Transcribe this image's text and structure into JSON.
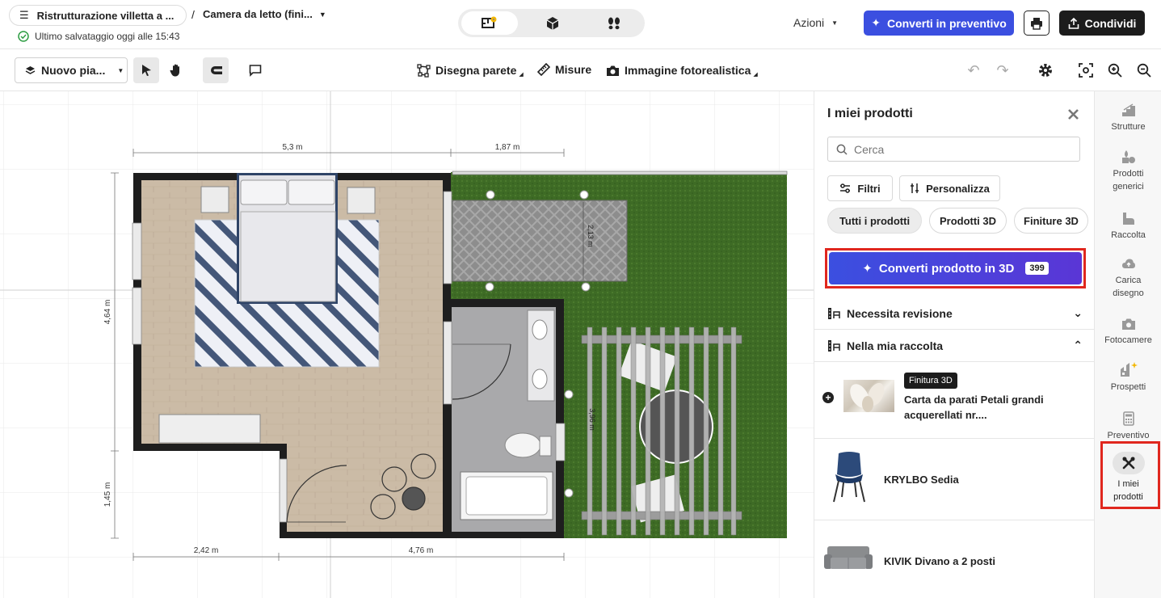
{
  "header": {
    "project_title": "Ristrutturazione villetta a ...",
    "separator": "/",
    "room_title": "Camera da letto (fini...",
    "save_status": "Ultimo salvataggio oggi alle 15:43",
    "actions_label": "Azioni",
    "convert_quote_label": "Converti in preventivo",
    "share_label": "Condividi"
  },
  "toolbar": {
    "floor_select": "Nuovo pia...",
    "draw_wall": "Disegna parete",
    "measures": "Misure",
    "photoreal": "Immagine fotorealistica"
  },
  "plan": {
    "dims": {
      "top_left": "5,3 m",
      "top_right": "1,87 m",
      "left_upper": "4,64 m",
      "left_lower": "1,45 m",
      "bottom_left": "2,42 m",
      "bottom_right": "4,76 m",
      "patio": "2,13 m",
      "pergola": "3,96 m"
    }
  },
  "panel": {
    "title": "I miei prodotti",
    "search_placeholder": "Cerca",
    "filters_label": "Filtri",
    "customize_label": "Personalizza",
    "chips": [
      "Tutti i prodotti",
      "Prodotti 3D",
      "Finiture 3D"
    ],
    "convert_label": "Converti prodotto in 3D",
    "convert_count": "399",
    "section_review": "Necessita revisione",
    "section_collection": "Nella mia raccolta",
    "products": [
      {
        "badge": "Finitura 3D",
        "name": "Carta da parati Petali grandi acquerellati nr...."
      },
      {
        "name": "KRYLBO Sedia"
      },
      {
        "name": "KIVIK Divano a 2 posti"
      }
    ]
  },
  "rail": {
    "items": [
      "Strutture",
      "Prodotti generici",
      "Raccolta",
      "Carica disegno",
      "Fotocamere",
      "Prospetti",
      "Preventivo",
      "I miei prodotti"
    ]
  },
  "colors": {
    "accent": "#3b4fe0",
    "highlight": "#e0271e",
    "grass": "#3d6b24",
    "wall": "#1e1e1e",
    "wood": "#c7b8a4"
  }
}
